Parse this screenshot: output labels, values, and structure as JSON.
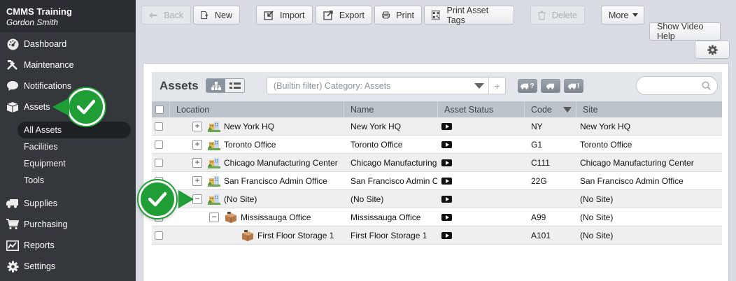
{
  "sidebar": {
    "app_title": "CMMS Training",
    "user_name": "Gordon Smith",
    "nav": [
      {
        "label": "Dashboard",
        "icon": "dashboard-icon"
      },
      {
        "label": "Maintenance",
        "icon": "tools-icon"
      },
      {
        "label": "Notifications",
        "icon": "chat-bubble-icon"
      },
      {
        "label": "Assets",
        "icon": "box-icon"
      },
      {
        "label": "Supplies",
        "icon": "truck-icon"
      },
      {
        "label": "Purchasing",
        "icon": "cart-icon"
      },
      {
        "label": "Reports",
        "icon": "chart-icon"
      },
      {
        "label": "Settings",
        "icon": "gear-icon"
      }
    ],
    "asset_subitems": [
      "All Assets",
      "Facilities",
      "Equipment",
      "Tools"
    ]
  },
  "toolbar": {
    "back": "Back",
    "new": "New",
    "import": "Import",
    "export": "Export",
    "print": "Print",
    "print_tags": "Print Asset Tags",
    "delete": "Delete",
    "more": "More",
    "video": "Show Video Help"
  },
  "panel": {
    "title": "Assets",
    "filter_text": "(Builtin filter) Category: Assets",
    "filter_buttons": [
      "?",
      "",
      "!"
    ],
    "search_value": ""
  },
  "table": {
    "columns": [
      "Location",
      "Name",
      "Asset Status",
      "Code",
      "Site"
    ],
    "rows": [
      {
        "location": "New York HQ",
        "name": "New York HQ",
        "code": "NY",
        "site": "New York HQ",
        "expander": "+",
        "icon": "building-icon",
        "indent": 0
      },
      {
        "location": "Toronto Office",
        "name": "Toronto Office",
        "code": "G1",
        "site": "Toronto Office",
        "expander": "+",
        "icon": "building-icon",
        "indent": 0
      },
      {
        "location": "Chicago Manufacturing Center",
        "name": "Chicago Manufacturing...",
        "code": "C111",
        "site": "Chicago Manufacturing Center",
        "expander": "+",
        "icon": "building-icon",
        "indent": 0
      },
      {
        "location": "San Francisco Admin Office",
        "name": "San Francisco Admin O...",
        "code": "22G",
        "site": "San Francisco Admin Office",
        "expander": "+",
        "icon": "building-icon",
        "indent": 0
      },
      {
        "location": "(No Site)",
        "name": "(No Site)",
        "code": "",
        "site": "(No Site)",
        "expander": "−",
        "icon": "building-icon",
        "indent": 0
      },
      {
        "location": "Mississauga Office",
        "name": "Mississauga Office",
        "code": "A99",
        "site": "(No Site)",
        "expander": "−",
        "icon": "box-icon",
        "indent": 1
      },
      {
        "location": "First Floor Storage 1",
        "name": "First Floor Storage 1",
        "code": "A101",
        "site": "(No Site)",
        "expander": "",
        "icon": "box-icon",
        "indent": 2
      }
    ]
  },
  "colors": {
    "sidebar_bg": "#34383d",
    "check_green": "#1f9e35",
    "header_bg": "#bcc3cb"
  }
}
